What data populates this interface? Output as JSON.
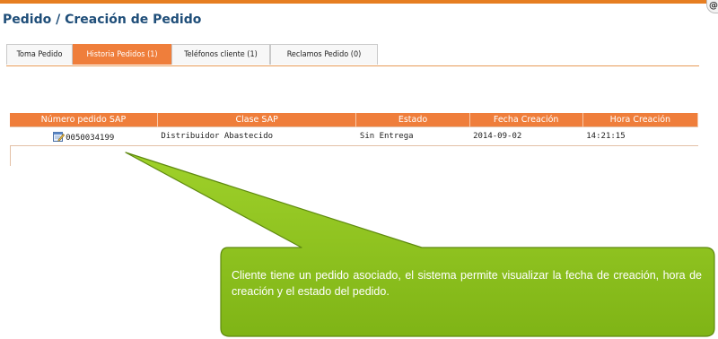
{
  "header": {
    "title": "Pedido / Creación de Pedido",
    "corner_glyph": "@"
  },
  "tabs": [
    {
      "label": "Toma Pedido"
    },
    {
      "label": "Historia Pedidos (1)",
      "active": true
    },
    {
      "label": "Teléfonos cliente (1)"
    },
    {
      "label": "Reclamos Pedido (0)"
    }
  ],
  "table": {
    "columns": [
      "Número pedido SAP",
      "Clase SAP",
      "Estado",
      "Fecha Creación",
      "Hora Creación"
    ],
    "rows": [
      {
        "numero": "0050034199",
        "clase": "Distribuidor Abastecido",
        "estado": "Sin Entrega",
        "fecha": "2014-09-02",
        "hora": "14:21:15",
        "icon": "edit-document-icon"
      }
    ]
  },
  "callout": {
    "text": "Cliente tiene un pedido asociado, el sistema permite visualizar la fecha de creación, hora de creación y el estado del pedido.",
    "color": "#8dc21f"
  },
  "colors": {
    "accent": "#ef7e3b",
    "title": "#1f4e79",
    "callout_border": "#5f8a10"
  }
}
